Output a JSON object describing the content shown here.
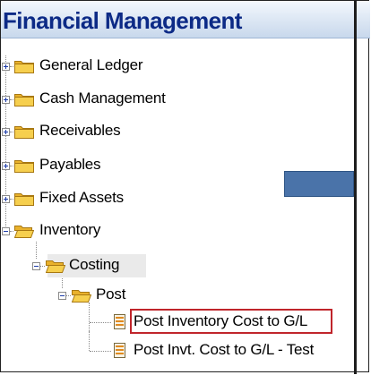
{
  "header": {
    "title": "Financial Management"
  },
  "tree": {
    "items": [
      {
        "label": "General Ledger"
      },
      {
        "label": "Cash Management"
      },
      {
        "label": "Receivables"
      },
      {
        "label": "Payables"
      },
      {
        "label": "Fixed Assets"
      },
      {
        "label": "Inventory"
      },
      {
        "label": "Costing"
      },
      {
        "label": "Post"
      },
      {
        "label": "Post Inventory Cost to G/L"
      },
      {
        "label": "Post Invt. Cost to G/L - Test"
      }
    ]
  },
  "colors": {
    "title": "#0c2a86",
    "highlight": "#c0252b",
    "button": "#4a73a9",
    "folder": "#f3c53a"
  }
}
